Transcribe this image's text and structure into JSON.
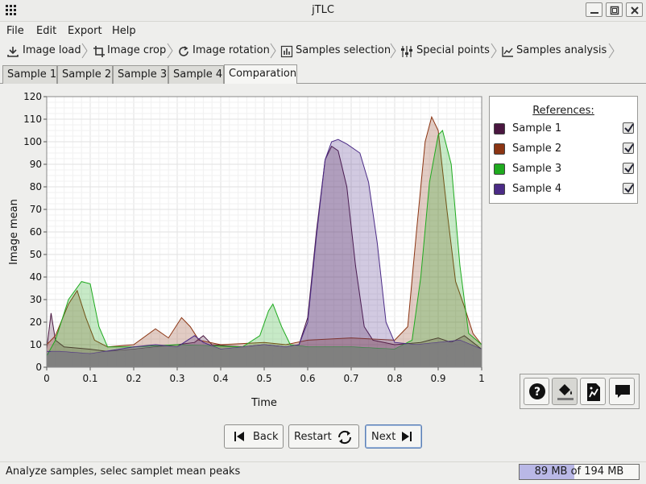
{
  "window": {
    "title": "jTLC"
  },
  "menu": [
    "File",
    "Edit",
    "Export",
    "Help"
  ],
  "wizard_steps": [
    {
      "label": "Image load",
      "icon": "download-icon"
    },
    {
      "label": "Image crop",
      "icon": "crop-icon"
    },
    {
      "label": "Image rotation",
      "icon": "rotate-icon"
    },
    {
      "label": "Samples selection",
      "icon": "bar-chart-icon"
    },
    {
      "label": "Special points",
      "icon": "sliders-icon"
    },
    {
      "label": "Samples analysis",
      "icon": "line-chart-icon"
    }
  ],
  "tabs": [
    {
      "label": "Sample 1",
      "active": false
    },
    {
      "label": "Sample 2",
      "active": false
    },
    {
      "label": "Sample 3",
      "active": false
    },
    {
      "label": "Sample 4",
      "active": false
    },
    {
      "label": "Comparation",
      "active": true
    }
  ],
  "legend": {
    "title": "References:",
    "items": [
      {
        "label": "Sample 1",
        "color": "#4a1740",
        "checked": true
      },
      {
        "label": "Sample 2",
        "color": "#8b3513",
        "checked": true
      },
      {
        "label": "Sample 3",
        "color": "#1faa1f",
        "checked": true
      },
      {
        "label": "Sample 4",
        "color": "#4b2b86",
        "checked": true
      }
    ]
  },
  "chart_data": {
    "type": "area",
    "title": "",
    "xlabel": "Time",
    "ylabel": "Image mean",
    "xlim": [
      0,
      1
    ],
    "ylim": [
      0,
      120
    ],
    "x_ticks": [
      "0",
      "0.1",
      "0.2",
      "0.3",
      "0.4",
      "0.5",
      "0.6",
      "0.7",
      "0.8",
      "0.9",
      "1"
    ],
    "y_ticks": [
      "0",
      "10",
      "20",
      "30",
      "40",
      "50",
      "60",
      "70",
      "80",
      "90",
      "100",
      "110",
      "120"
    ],
    "grid": true,
    "series": [
      {
        "name": "Sample 1",
        "color": "#4a1740",
        "points": [
          [
            0,
            8
          ],
          [
            0.01,
            24
          ],
          [
            0.02,
            12
          ],
          [
            0.04,
            9
          ],
          [
            0.1,
            8
          ],
          [
            0.14,
            7
          ],
          [
            0.2,
            8
          ],
          [
            0.25,
            9
          ],
          [
            0.3,
            10
          ],
          [
            0.34,
            11
          ],
          [
            0.36,
            14
          ],
          [
            0.38,
            10
          ],
          [
            0.45,
            9
          ],
          [
            0.5,
            10
          ],
          [
            0.55,
            9
          ],
          [
            0.58,
            10
          ],
          [
            0.6,
            22
          ],
          [
            0.62,
            60
          ],
          [
            0.64,
            92
          ],
          [
            0.655,
            98
          ],
          [
            0.67,
            96
          ],
          [
            0.69,
            80
          ],
          [
            0.71,
            45
          ],
          [
            0.73,
            18
          ],
          [
            0.75,
            12
          ],
          [
            0.8,
            10
          ],
          [
            0.86,
            11
          ],
          [
            0.88,
            12
          ],
          [
            0.9,
            13
          ],
          [
            0.93,
            11
          ],
          [
            0.96,
            14
          ],
          [
            0.98,
            11
          ],
          [
            1,
            8
          ]
        ]
      },
      {
        "name": "Sample 2",
        "color": "#8b3513",
        "points": [
          [
            0,
            10
          ],
          [
            0.02,
            14
          ],
          [
            0.05,
            28
          ],
          [
            0.07,
            34
          ],
          [
            0.09,
            22
          ],
          [
            0.11,
            12
          ],
          [
            0.14,
            9
          ],
          [
            0.2,
            10
          ],
          [
            0.25,
            17
          ],
          [
            0.28,
            13
          ],
          [
            0.31,
            22
          ],
          [
            0.33,
            18
          ],
          [
            0.35,
            12
          ],
          [
            0.4,
            10
          ],
          [
            0.5,
            11
          ],
          [
            0.55,
            10
          ],
          [
            0.6,
            12
          ],
          [
            0.7,
            13
          ],
          [
            0.8,
            12
          ],
          [
            0.83,
            18
          ],
          [
            0.85,
            60
          ],
          [
            0.87,
            100
          ],
          [
            0.885,
            111
          ],
          [
            0.9,
            105
          ],
          [
            0.92,
            70
          ],
          [
            0.94,
            38
          ],
          [
            0.96,
            27
          ],
          [
            0.98,
            15
          ],
          [
            1,
            10
          ]
        ]
      },
      {
        "name": "Sample 3",
        "color": "#1faa1f",
        "points": [
          [
            0,
            5
          ],
          [
            0.02,
            12
          ],
          [
            0.05,
            30
          ],
          [
            0.08,
            38
          ],
          [
            0.1,
            37
          ],
          [
            0.12,
            18
          ],
          [
            0.14,
            9
          ],
          [
            0.2,
            9
          ],
          [
            0.3,
            10
          ],
          [
            0.45,
            9
          ],
          [
            0.49,
            14
          ],
          [
            0.51,
            25
          ],
          [
            0.52,
            28
          ],
          [
            0.54,
            18
          ],
          [
            0.56,
            10
          ],
          [
            0.6,
            9
          ],
          [
            0.7,
            9
          ],
          [
            0.8,
            8
          ],
          [
            0.84,
            12
          ],
          [
            0.86,
            40
          ],
          [
            0.88,
            82
          ],
          [
            0.9,
            103
          ],
          [
            0.91,
            105
          ],
          [
            0.93,
            90
          ],
          [
            0.95,
            45
          ],
          [
            0.97,
            15
          ],
          [
            1,
            10
          ]
        ]
      },
      {
        "name": "Sample 4",
        "color": "#4b2b86",
        "points": [
          [
            0,
            7
          ],
          [
            0.03,
            7
          ],
          [
            0.1,
            6
          ],
          [
            0.2,
            9
          ],
          [
            0.25,
            10
          ],
          [
            0.3,
            9
          ],
          [
            0.34,
            14
          ],
          [
            0.36,
            11
          ],
          [
            0.4,
            8
          ],
          [
            0.5,
            10
          ],
          [
            0.55,
            9
          ],
          [
            0.58,
            10
          ],
          [
            0.6,
            20
          ],
          [
            0.62,
            58
          ],
          [
            0.64,
            92
          ],
          [
            0.655,
            100
          ],
          [
            0.67,
            101
          ],
          [
            0.69,
            99
          ],
          [
            0.72,
            95
          ],
          [
            0.74,
            82
          ],
          [
            0.76,
            55
          ],
          [
            0.78,
            20
          ],
          [
            0.8,
            11
          ],
          [
            0.85,
            10
          ],
          [
            0.9,
            11
          ],
          [
            0.95,
            12
          ],
          [
            1,
            8
          ]
        ]
      }
    ],
    "baseline_color": "#7f7f7f"
  },
  "tools": [
    {
      "name": "help-button",
      "icon": "question-icon",
      "pressed": false
    },
    {
      "name": "fill-button",
      "icon": "paint-bucket-icon",
      "pressed": true
    },
    {
      "name": "export-chart-button",
      "icon": "chart-file-icon",
      "pressed": false
    },
    {
      "name": "comment-button",
      "icon": "speech-bubble-icon",
      "pressed": false
    }
  ],
  "nav": {
    "back": "Back",
    "restart": "Restart",
    "next": "Next"
  },
  "status": {
    "text": "Analyze samples, selec samplet mean peaks",
    "memory": "89 MB of 194 MB",
    "memory_fraction": 0.46
  }
}
